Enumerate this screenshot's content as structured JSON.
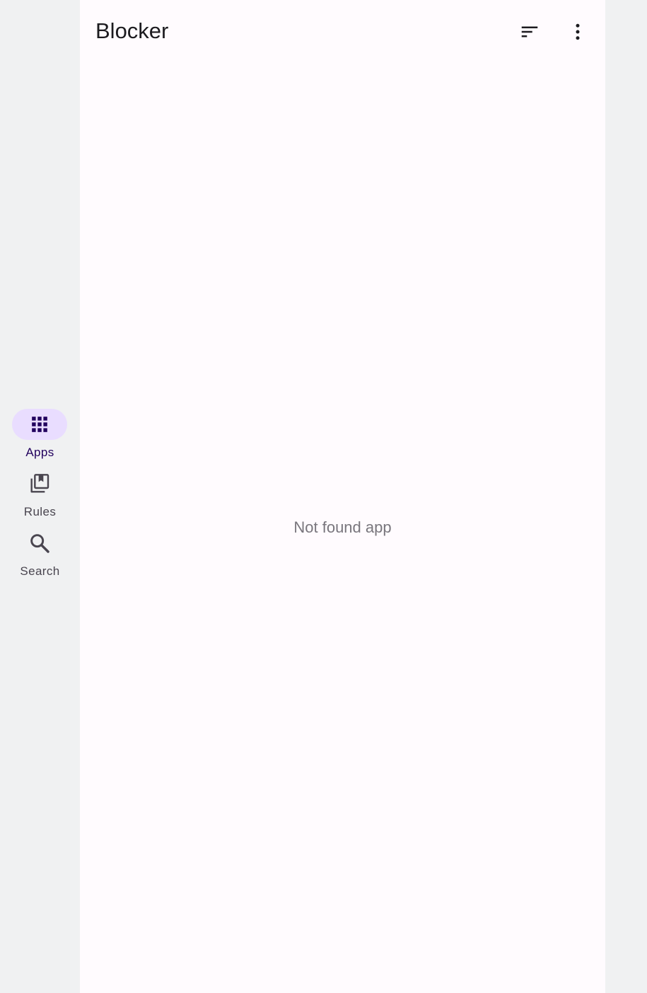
{
  "app": {
    "title": "Blocker"
  },
  "toolbar": {
    "sort_icon": "sort-icon",
    "more_icon": "more-vert-icon"
  },
  "nav": {
    "items": [
      {
        "label": "Apps",
        "icon": "apps-grid-icon",
        "active": true
      },
      {
        "label": "Rules",
        "icon": "rules-library-icon",
        "active": false
      },
      {
        "label": "Search",
        "icon": "search-icon",
        "active": false
      }
    ]
  },
  "main": {
    "empty_message": "Not found app"
  },
  "colors": {
    "accent_indicator": "#e9ddff",
    "active_label": "#21005d",
    "surface": "#fffbfe",
    "rail_background": "#f0f1f2"
  }
}
